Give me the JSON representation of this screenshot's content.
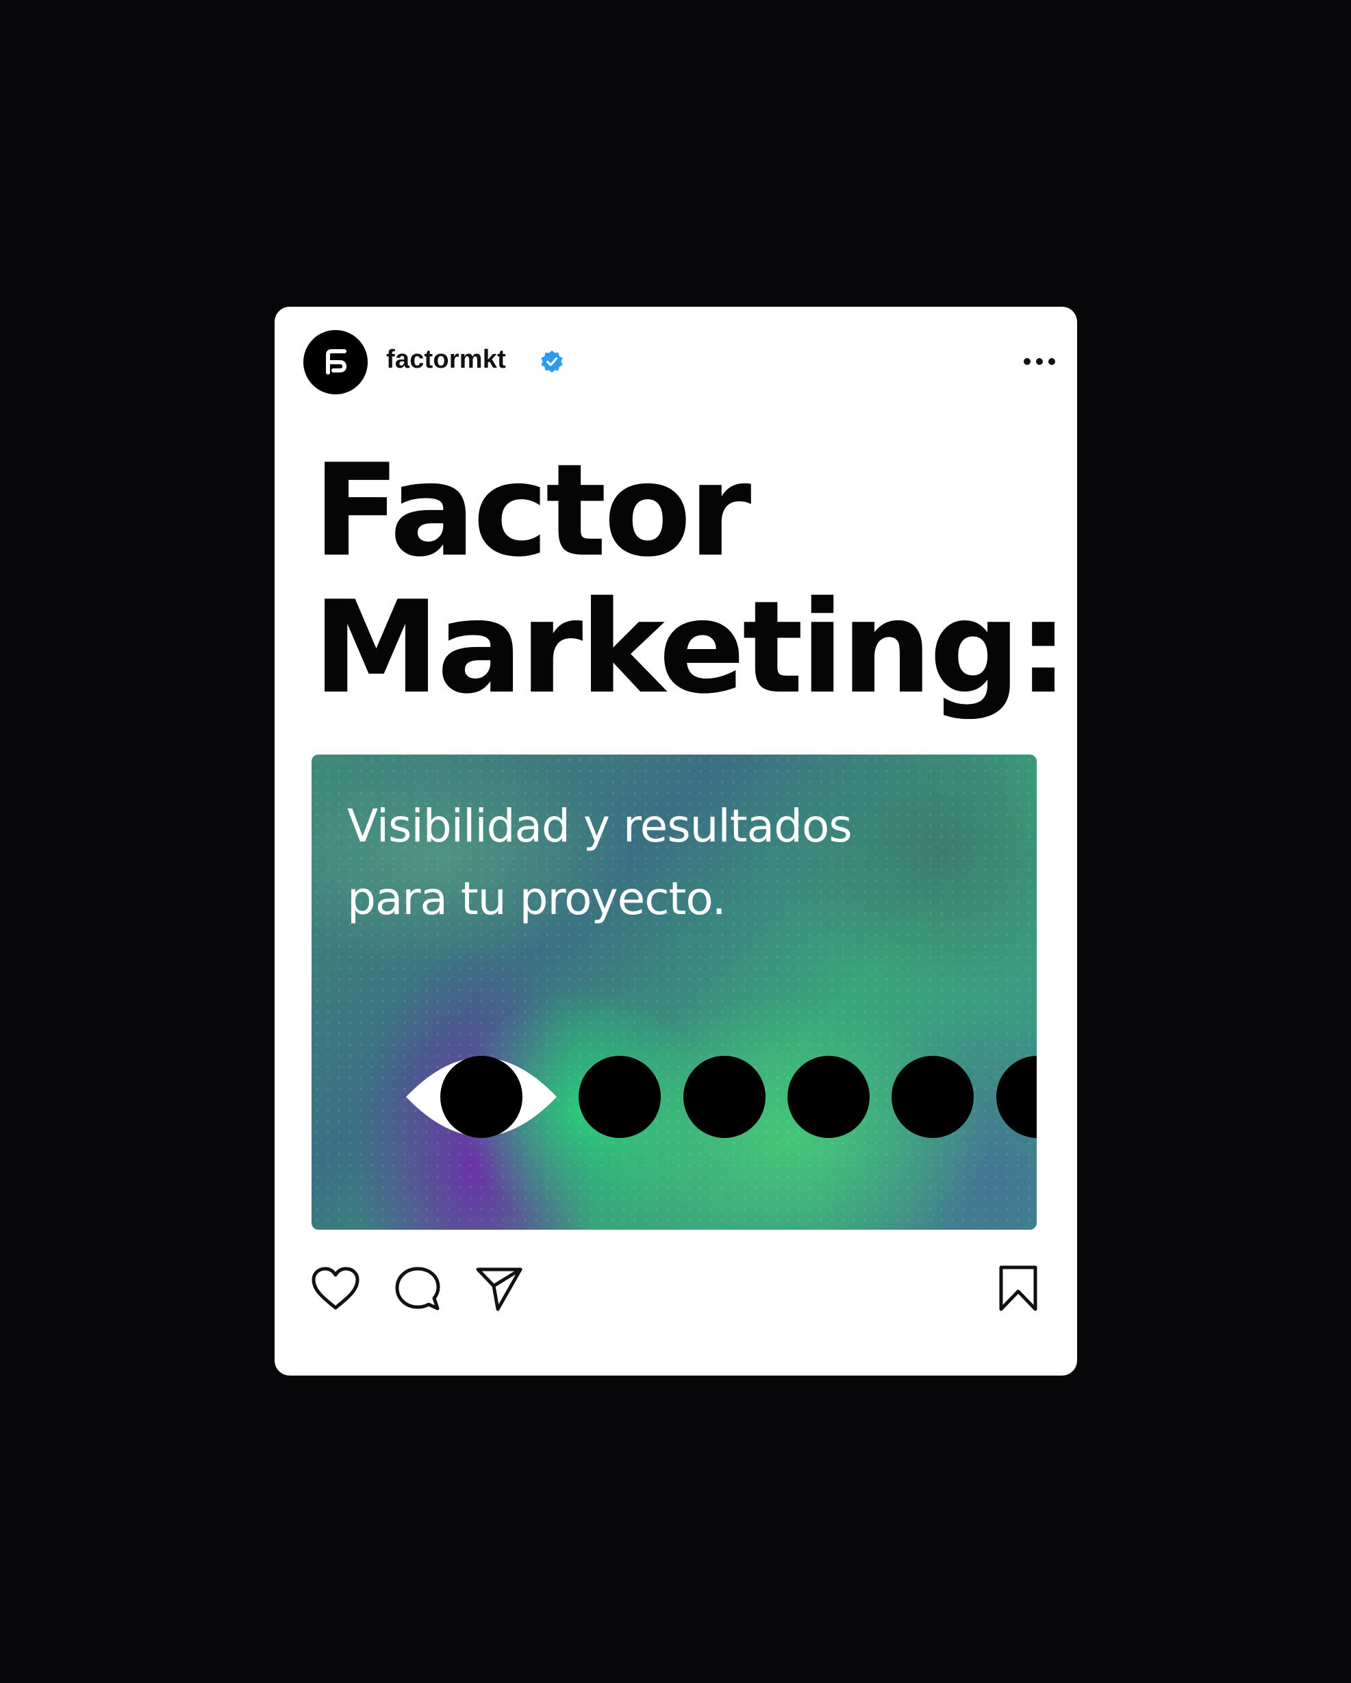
{
  "post": {
    "username": "factormkt",
    "verified": true,
    "headline": {
      "line1": "Factor",
      "line2": "Marketing:"
    },
    "banner": {
      "line1": "Visibilidad y resultados",
      "line2": "para tu proyecto."
    }
  },
  "icons": {
    "avatar_logo": "factor-logo-icon",
    "verified_badge": "verified-badge-icon",
    "more": "more-options-icon",
    "like": "heart-icon",
    "comment": "comment-icon",
    "share": "send-icon",
    "save": "bookmark-icon",
    "eye": "eye-icon"
  },
  "colors": {
    "background": "#07070a",
    "card": "#ffffff",
    "text": "#050505",
    "verified": "#2d9bf0",
    "banner_green": "#3aa57a",
    "banner_purple": "#6e2daa"
  }
}
